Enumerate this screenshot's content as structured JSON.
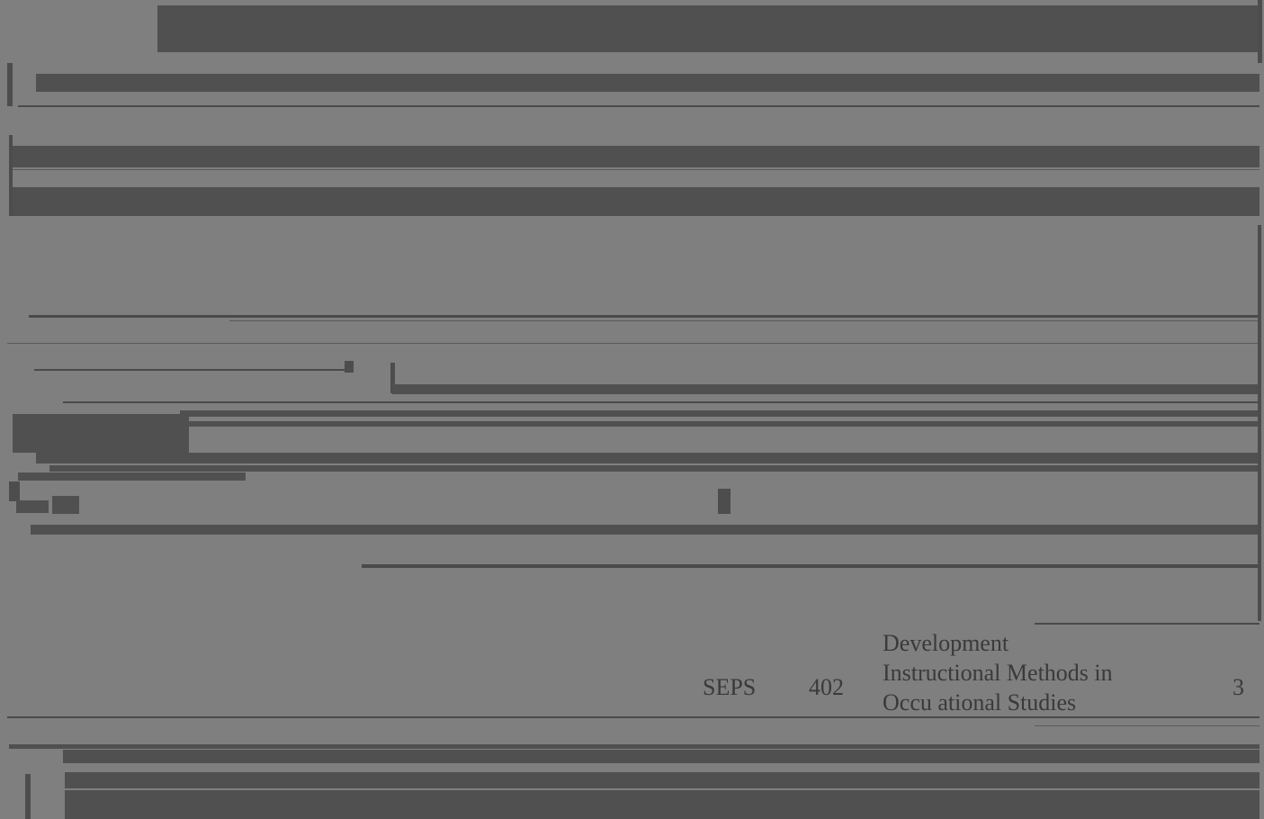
{
  "table_row": {
    "dept": "SEPS",
    "number": "402",
    "title_lines": [
      "Development",
      "Instructional Methods in",
      "Occu  ational Studies"
    ],
    "credits": "3"
  },
  "colors": {
    "background": "#808080",
    "bars": "#505050",
    "text": "#3a3a3a"
  }
}
